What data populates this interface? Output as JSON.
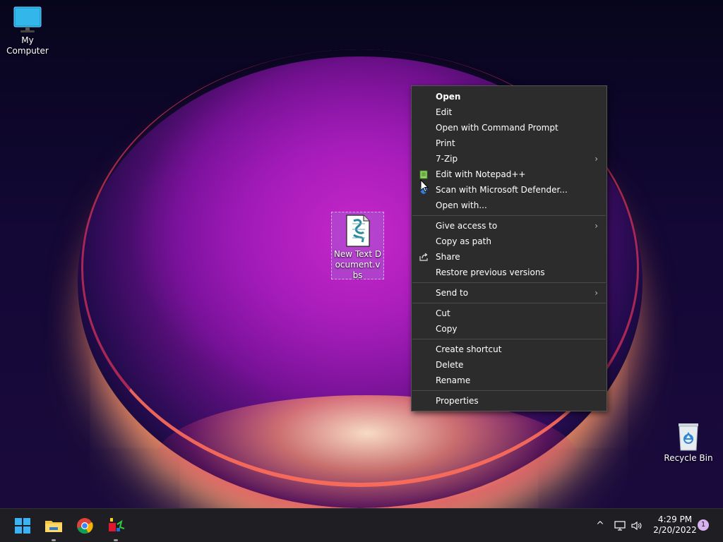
{
  "desktop": {
    "icons": [
      {
        "label": "My Computer",
        "icon": "monitor-icon"
      },
      {
        "label": "New Text Document.vbs",
        "icon": "vbs-script-icon"
      },
      {
        "label": "Recycle Bin",
        "icon": "recycle-bin-icon"
      }
    ]
  },
  "context_menu": {
    "groups": [
      [
        {
          "label": "Open",
          "bold": true
        },
        {
          "label": "Edit"
        },
        {
          "label": "Open with Command Prompt"
        },
        {
          "label": "Print"
        },
        {
          "label": "7-Zip",
          "submenu": true
        },
        {
          "label": "Edit with Notepad++",
          "icon": "notepad-plus-plus-icon"
        },
        {
          "label": "Scan with Microsoft Defender...",
          "icon": "defender-shield-icon"
        },
        {
          "label": "Open with..."
        }
      ],
      [
        {
          "label": "Give access to",
          "submenu": true
        },
        {
          "label": "Copy as path"
        },
        {
          "label": "Share",
          "icon": "share-icon"
        },
        {
          "label": "Restore previous versions"
        }
      ],
      [
        {
          "label": "Send to",
          "submenu": true
        }
      ],
      [
        {
          "label": "Cut"
        },
        {
          "label": "Copy"
        }
      ],
      [
        {
          "label": "Create shortcut"
        },
        {
          "label": "Delete"
        },
        {
          "label": "Rename"
        }
      ],
      [
        {
          "label": "Properties"
        }
      ]
    ],
    "submenu_glyph": "›"
  },
  "taskbar": {
    "apps": [
      {
        "name": "start",
        "icon": "windows-logo-icon"
      },
      {
        "name": "file-explorer",
        "icon": "folder-icon",
        "running": true
      },
      {
        "name": "chrome",
        "icon": "chrome-icon"
      },
      {
        "name": "app",
        "icon": "colorful-app-icon",
        "running": true
      }
    ],
    "tray": {
      "chevron": "^",
      "icons": [
        "network-icon",
        "volume-icon"
      ],
      "time": "4:29 PM",
      "date": "2/20/2022",
      "notification_count": "1"
    }
  }
}
